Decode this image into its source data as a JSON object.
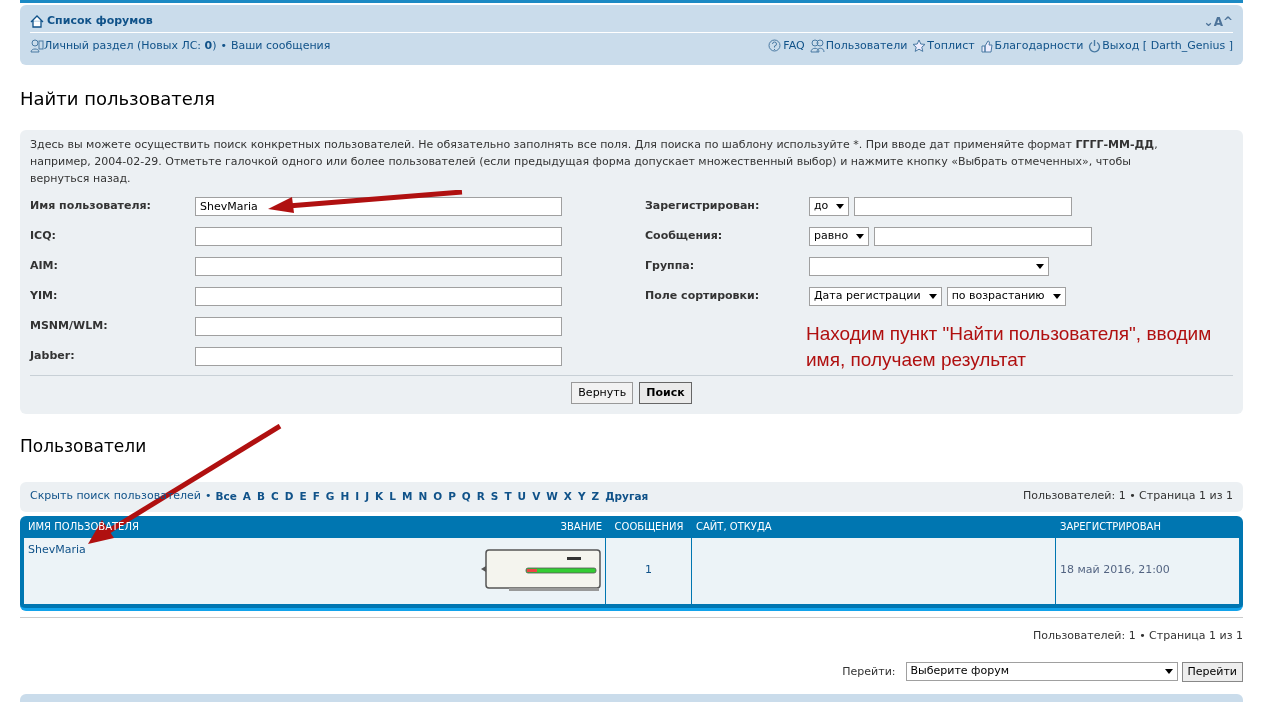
{
  "navbar": {
    "home_link": "Список форумов",
    "font_controls": "⌄A^",
    "left_links": [
      {
        "kind": "ucp",
        "text": "Личный раздел (Новых ЛС: **0**)"
      },
      {
        "kind": "plain",
        "text": "Ваши сообщения"
      }
    ],
    "left_separator": "•",
    "right_links": [
      {
        "kind": "faq",
        "text": "FAQ"
      },
      {
        "kind": "users",
        "text": "Пользователи"
      },
      {
        "kind": "star",
        "text": "Топлист"
      },
      {
        "kind": "thumb",
        "text": "Благодарности"
      },
      {
        "kind": "power",
        "text": "Выход [ Darth_Genius ]"
      }
    ]
  },
  "search_title": "Найти пользователя",
  "search_form": {
    "description": "Здесь вы можете осуществить поиск конкретных пользователей. Не обязательно заполнять все поля. Для поиска по шаблону используйте *. При вводе дат применяйте формат **ГГГГ-ММ-ДД**, например, 2004-02-29. Отметьте галочкой одного или более пользователей (если предыдущая форма допускает множественный выбор) и нажмите кнопку «Выбрать отмеченных», чтобы вернуться назад.",
    "left_fields": [
      {
        "label": "Имя пользователя:",
        "value": "ShevMaria"
      },
      {
        "label": "ICQ:"
      },
      {
        "label": "AIM:"
      },
      {
        "label": "YIM:"
      },
      {
        "label": "MSNM/WLM:"
      },
      {
        "label": "Jabber:"
      }
    ],
    "right_fields": [
      {
        "label": "Зарегистрирован:",
        "controls": [
          {
            "kind": "select",
            "value": "до"
          },
          {
            "kind": "input"
          }
        ]
      },
      {
        "label": "Сообщения:",
        "controls": [
          {
            "kind": "select",
            "value": "равно"
          },
          {
            "kind": "input"
          }
        ]
      },
      {
        "label": "Группа:",
        "controls": [
          {
            "kind": "wide_select"
          }
        ]
      },
      {
        "label": "Поле сортировки:",
        "controls": [
          {
            "kind": "select",
            "value": "Дата регистрации"
          },
          {
            "kind": "select",
            "value": "по возрастанию"
          }
        ]
      }
    ],
    "annotation": "Находим пункт \"Найти пользователя\", вводим имя, получаем результат",
    "buttons": [
      {
        "label": "Вернуть",
        "primary": false
      },
      {
        "label": "Поиск",
        "primary": true
      }
    ]
  },
  "results_title": "Пользователи",
  "filter_bar": {
    "hide_link": "Скрыть поиск пользователей",
    "separator": "•",
    "letters": [
      "Все",
      "A",
      "B",
      "C",
      "D",
      "E",
      "F",
      "G",
      "H",
      "I",
      "J",
      "K",
      "L",
      "M",
      "N",
      "O",
      "P",
      "Q",
      "R",
      "S",
      "T",
      "U",
      "V",
      "W",
      "X",
      "Y",
      "Z",
      "Другая"
    ],
    "pagination": "Пользователей: 1 • Страница 1 из 1"
  },
  "table": {
    "columns": [
      "ИМЯ ПОЛЬЗОВАТЕЛЯ",
      "ЗВАНИЕ",
      "СООБЩЕНИЯ",
      "САЙТ, ОТКУДА",
      "ЗАРЕГИСТРИРОВАН"
    ],
    "rows": [
      {
        "name": "ShevMaria",
        "posts": "1",
        "registered": "18 май 2016, 21:00"
      }
    ]
  },
  "footer": {
    "pagination": "Пользователей: 1 • Страница 1 из 1",
    "jump_label": "Перейти:",
    "jump_select": "Выберите форум",
    "jump_button": "Перейти"
  }
}
